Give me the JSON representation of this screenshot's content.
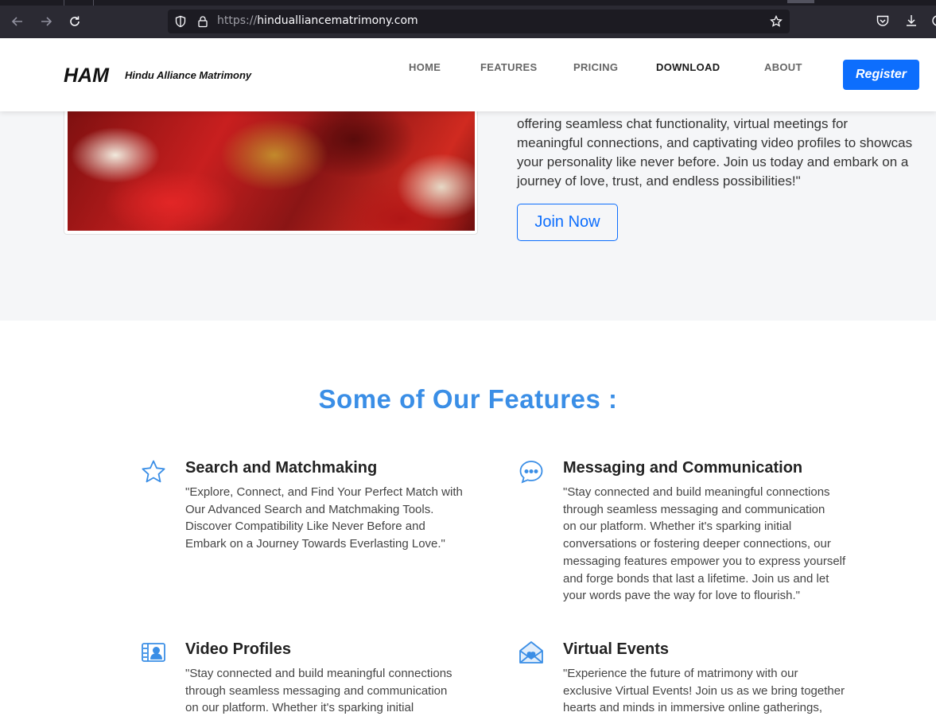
{
  "browser": {
    "url_protocol": "https://",
    "url_host": "hindualliancematrimony.com"
  },
  "header": {
    "logo": "HAM",
    "logo_subtitle": "Hindu Alliance Matrimony",
    "nav": [
      {
        "label": "HOME"
      },
      {
        "label": "FEATURES"
      },
      {
        "label": "PRICING"
      },
      {
        "label": "DOWNLOAD"
      },
      {
        "label": "ABOUT"
      }
    ],
    "register_label": "Register"
  },
  "hero": {
    "lines": [
      "offering seamless chat functionality, virtual meetings for",
      "meaningful connections, and captivating video profiles to showcas",
      "your personality like never before. Join us today and embark on a",
      "journey of love, trust, and endless possibilities!\""
    ],
    "join_label": "Join Now"
  },
  "features": {
    "title": "Some of Our Features :",
    "items": [
      {
        "icon": "star-icon",
        "title": "Search and Matchmaking",
        "lines": [
          "\"Explore, Connect, and Find Your Perfect Match with",
          "Our Advanced Search and Matchmaking Tools.",
          "Discover Compatibility Like Never Before and",
          "Embark on a Journey Towards Everlasting Love.\""
        ]
      },
      {
        "icon": "chat-icon",
        "title": "Messaging and Communication",
        "lines": [
          "\"Stay connected and build meaningful connections",
          "through seamless messaging and communication",
          "on our platform. Whether it's sparking initial",
          "conversations or fostering deeper connections, our",
          "messaging features empower you to express yourself",
          "and forge bonds that last a lifetime. Join us and let",
          "your words pave the way for love to flourish.\""
        ]
      },
      {
        "icon": "video-profile-icon",
        "title": "Video Profiles",
        "lines": [
          "\"Stay connected and build meaningful connections",
          "through seamless messaging and communication",
          "on our platform. Whether it's sparking initial"
        ]
      },
      {
        "icon": "envelope-heart-icon",
        "title": "Virtual Events",
        "lines": [
          "\"Experience the future of matrimony with our",
          "exclusive Virtual Events! Join us as we bring together",
          "hearts and minds in immersive online gatherings,"
        ]
      }
    ]
  },
  "colors": {
    "accent": "#3a8ee6",
    "primary": "#0d6efd"
  }
}
